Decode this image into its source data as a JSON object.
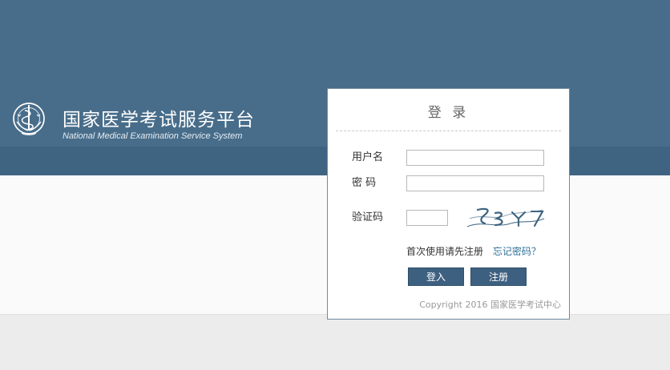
{
  "header": {
    "title_cn": "国家医学考试服务平台",
    "title_en": "National Medical Examination Service System"
  },
  "login": {
    "title": "登 录",
    "username_label": "用户名",
    "password_label": "密 码",
    "captcha_label": "验证码",
    "username_value": "",
    "password_value": "",
    "captcha_value": "",
    "register_hint": "首次使用请先注册",
    "forgot_link": "忘记密码？",
    "login_button": "登入",
    "register_button": "注册",
    "copyright": "Copyright 2016 国家医学考试中心",
    "captcha_icon": "captcha-image"
  },
  "colors": {
    "header_bg": "#486d8a",
    "band_bg": "#3f6482",
    "button_bg": "#3e6080",
    "link": "#2f6f99"
  }
}
